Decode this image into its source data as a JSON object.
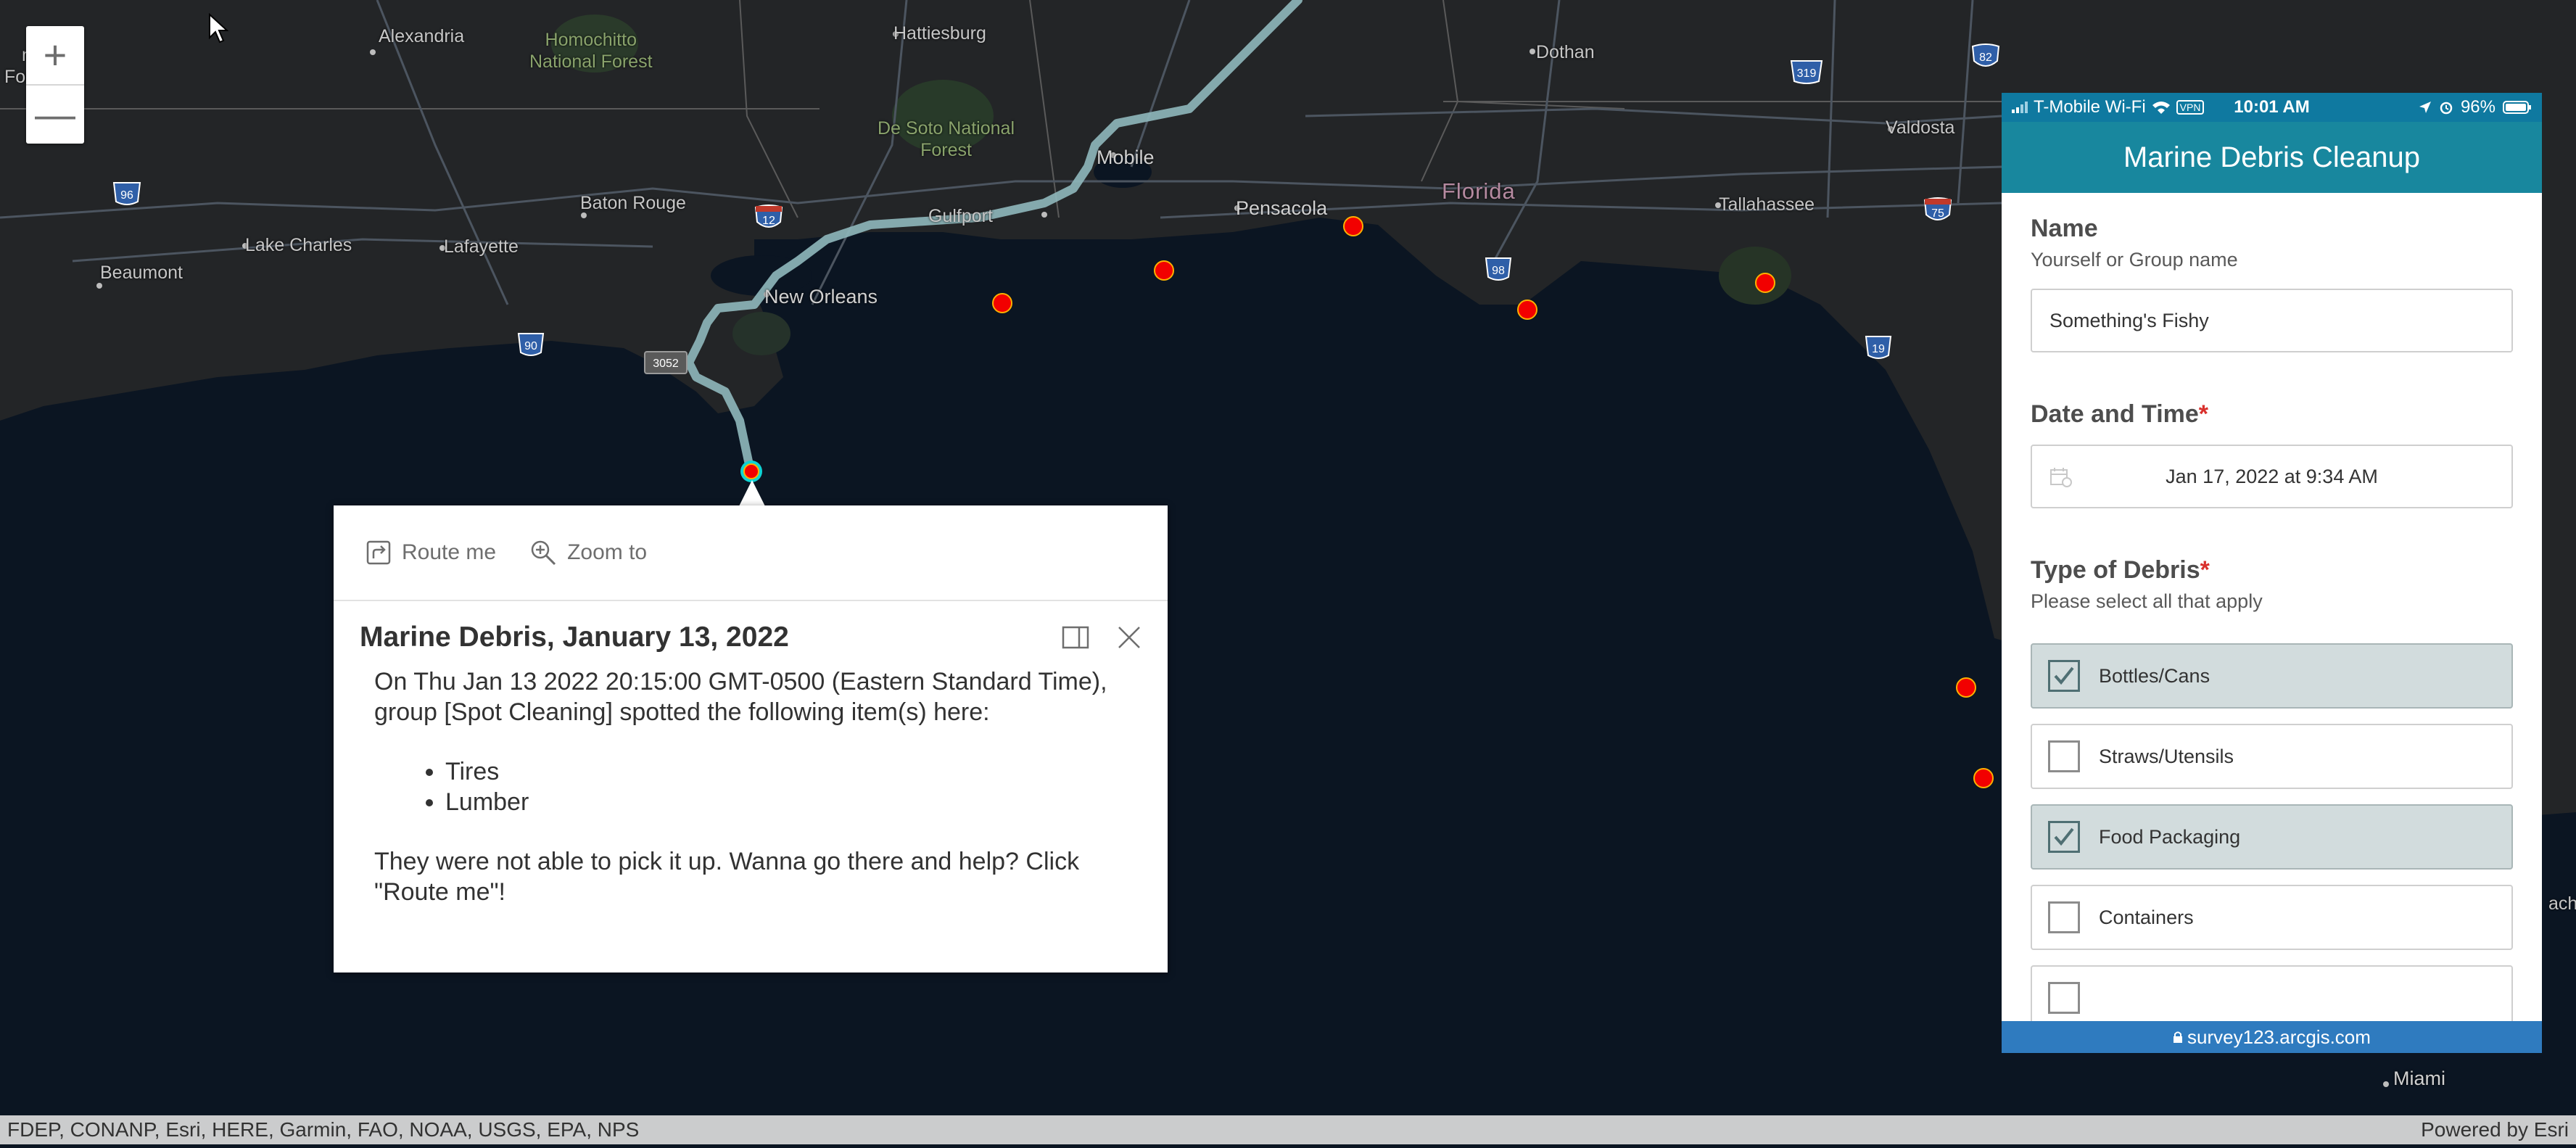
{
  "map": {
    "labels": {
      "alexandria": "Alexandria",
      "homochitto": "Homochitto\nNational Forest",
      "hattiesburg": "Hattiesburg",
      "desoto": "De Soto National\nForest",
      "mobile": "Mobile",
      "dothan": "Dothan",
      "valdosta": "Valdosta",
      "baton_rouge": "Baton Rouge",
      "lake_charles": "Lake Charles",
      "lafayette": "Lafayette",
      "beaumont": "Beaumont",
      "new_orleans": "New Orleans",
      "gulfport": "Gulfport",
      "pensacola": "Pensacola",
      "florida": "Florida",
      "tallahassee": "Tallahassee",
      "miami": "Miami",
      "ach": "ach",
      "kisatchie_a": "na",
      "kisatchie_b": "Forest"
    },
    "shields": {
      "i82": "82",
      "us319": "319",
      "i96": "96",
      "i12": "12",
      "i75": "75",
      "us98": "98",
      "us90": "90",
      "r3052": "3052",
      "us19": "19"
    },
    "accent": "#f20000",
    "route_color": "#8fb8bd"
  },
  "zoom": {
    "in": "+",
    "out": "—"
  },
  "popup": {
    "route_label": "Route me",
    "zoom_label": "Zoom to",
    "title": "Marine Debris, January 13, 2022",
    "intro": "On Thu Jan 13 2022 20:15:00 GMT-0500 (Eastern Standard Time), group [Spot Cleaning] spotted the following item(s) here:",
    "items": [
      "Tires",
      "Lumber"
    ],
    "outro": "They were not able to pick it up. Wanna go there and help? Click \"Route me\"!"
  },
  "phone": {
    "carrier": "T-Mobile Wi-Fi",
    "vpn": "VPN",
    "time": "10:01 AM",
    "battery": "96%",
    "app_title": "Marine Debris Cleanup",
    "q_name": {
      "title": "Name",
      "hint": "Yourself or Group name",
      "value": "Something's Fishy"
    },
    "q_date": {
      "title": "Date and Time",
      "required": "*",
      "value": "Jan 17, 2022 at 9:34 AM"
    },
    "q_type": {
      "title": "Type of Debris",
      "required": "*",
      "hint": "Please select all that apply"
    },
    "options": [
      {
        "label": "Bottles/Cans",
        "checked": true
      },
      {
        "label": "Straws/Utensils",
        "checked": false
      },
      {
        "label": "Food Packaging",
        "checked": true
      },
      {
        "label": "Containers",
        "checked": false
      }
    ],
    "url": "survey123.arcgis.com"
  },
  "attribution": {
    "sources": "FDEP, CONANP, Esri, HERE, Garmin, FAO, NOAA, USGS, EPA, NPS",
    "powered": "Powered by Esri"
  }
}
